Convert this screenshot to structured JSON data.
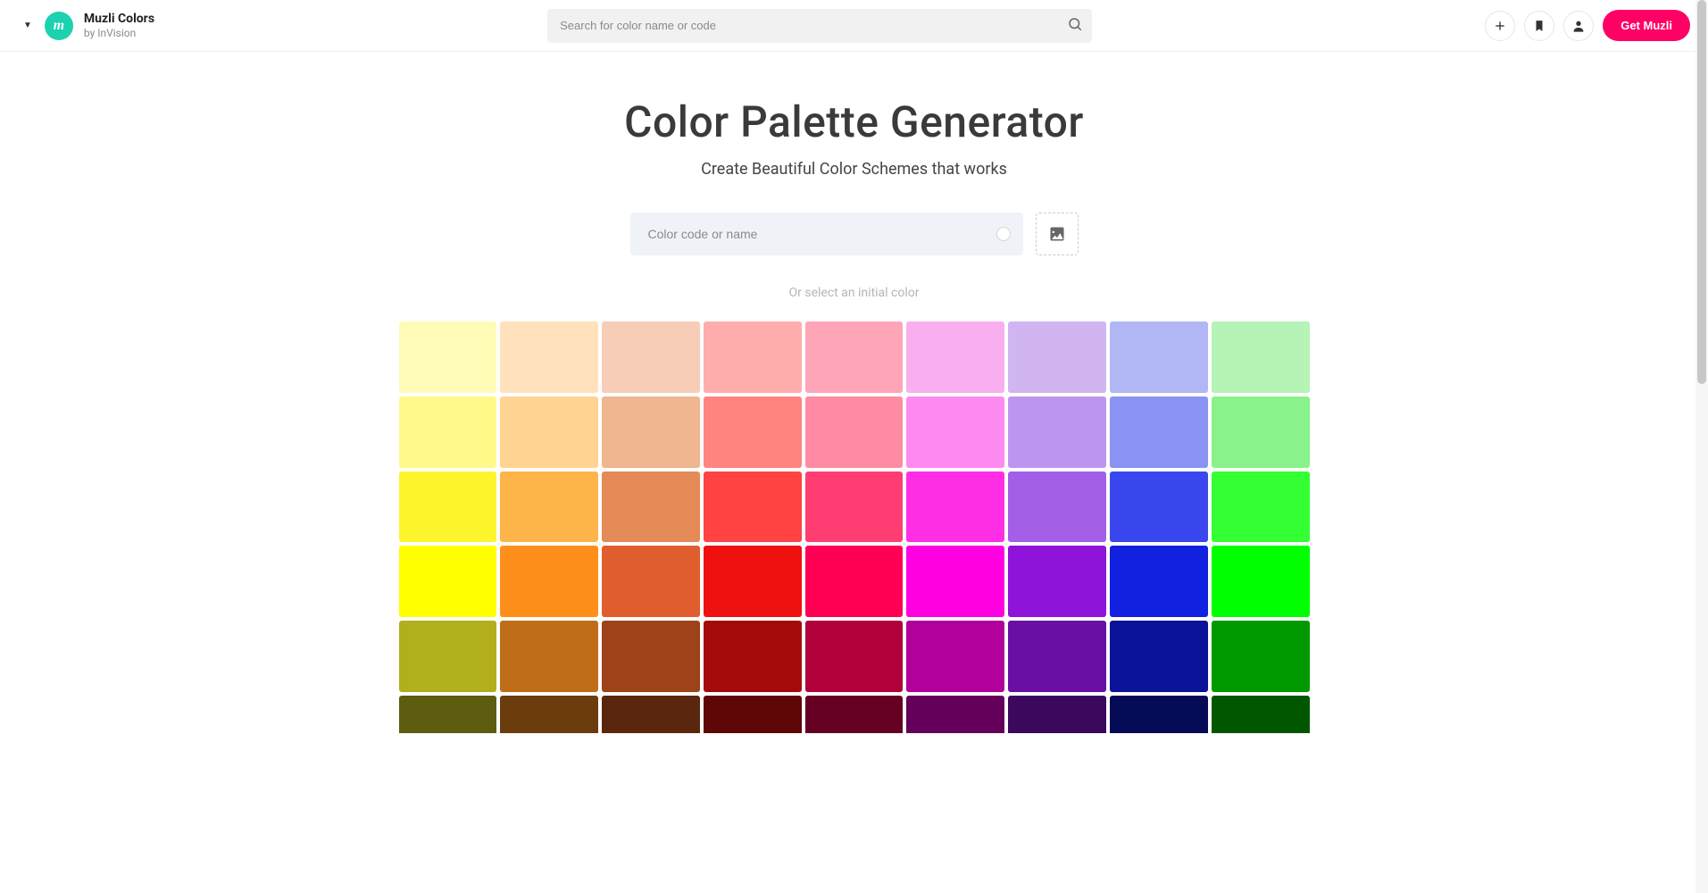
{
  "header": {
    "brand_title": "Muzli Colors",
    "brand_subtitle": "by InVision",
    "logo_letter": "m",
    "search_placeholder": "Search for color name or code",
    "cta_label": "Get Muzli"
  },
  "main": {
    "title": "Color Palette Generator",
    "subtitle": "Create Beautiful Color Schemes that works",
    "color_input_placeholder": "Color code or name",
    "helper_text": "Or select an initial color"
  },
  "swatches": [
    [
      "#fffcb8",
      "#ffe2bb",
      "#f7cdb8",
      "#ffadac",
      "#ffa5b8",
      "#f9afef",
      "#d0b5f1",
      "#b0b7f4",
      "#b6f3b6"
    ],
    [
      "#fff98a",
      "#ffd392",
      "#efb68f",
      "#ff837f",
      "#ff8aa3",
      "#ff8af2",
      "#bd95ef",
      "#8a93f4",
      "#8af28a"
    ],
    [
      "#fff52d",
      "#ffb44a",
      "#e38a57",
      "#ff4242",
      "#ff3d73",
      "#ff2ee5",
      "#a35fe8",
      "#3b47ee",
      "#33ff33"
    ],
    [
      "#ffff00",
      "#ff8f1b",
      "#e05e2d",
      "#ef1010",
      "#ff0054",
      "#ff00e0",
      "#9013d9",
      "#1220e0",
      "#00ff00"
    ],
    [
      "#b2af1d",
      "#c06d18",
      "#9e4219",
      "#a50a0a",
      "#b2003b",
      "#b1009b",
      "#6a0fa3",
      "#0a1399",
      "#009a00"
    ],
    [
      "#5d5c0f",
      "#6b3c0e",
      "#5a260e",
      "#5f0606",
      "#650022",
      "#65005a",
      "#3c085e",
      "#060b57",
      "#005700"
    ]
  ]
}
